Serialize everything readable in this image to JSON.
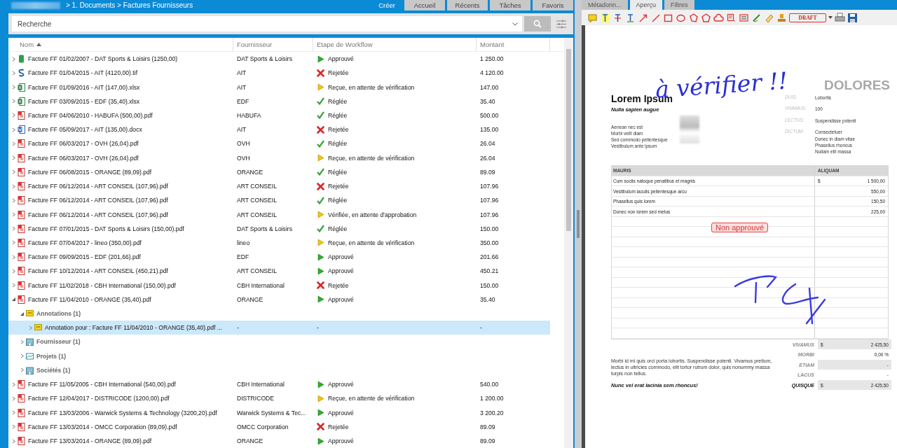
{
  "top_bar": {
    "breadcrumb": "> 1. Documents > Factures Fournisseurs",
    "create_label": "Créer",
    "tabs": [
      {
        "label": "Accueil",
        "selected": false
      },
      {
        "label": "Récents",
        "selected": false
      },
      {
        "label": "Tâches",
        "selected": false
      },
      {
        "label": "Favoris",
        "selected": false
      }
    ]
  },
  "search": {
    "placeholder": "Recherche"
  },
  "table": {
    "columns": [
      {
        "label": "Nom",
        "sorted": true
      },
      {
        "label": "Fournisseur",
        "sorted": false
      },
      {
        "label": "Etape de Workflow",
        "sorted": false
      },
      {
        "label": "Montant",
        "sorted": false
      }
    ],
    "rows": [
      {
        "kind": "file",
        "name": "Facture FF 01/02/2007 - DAT Sports & Loisirs (1250,00)",
        "supplier": "DAT Sports & Loisirs",
        "workflow": {
          "label": "Approuvé",
          "kind": "approved"
        },
        "amount": "1 250.00",
        "expanded": false,
        "selected": false
      },
      {
        "kind": "image",
        "name": "Facture FF 01/04/2015 - AIT (4120,00).tif",
        "supplier": "AIT",
        "workflow": {
          "label": "Rejetée",
          "kind": "rejected"
        },
        "amount": "4 120.00",
        "expanded": false,
        "selected": false
      },
      {
        "kind": "sheet",
        "name": "Facture FF 01/09/2016 - AIT (147,00).xlsx",
        "supplier": "AIT",
        "workflow": {
          "label": "Reçue, en attente de vérification",
          "kind": "pending"
        },
        "amount": "147.00",
        "expanded": false,
        "selected": false
      },
      {
        "kind": "sheet",
        "name": "Facture FF 03/09/2015 - EDF (35,40).xlsx",
        "supplier": "EDF",
        "workflow": {
          "label": "Réglée",
          "kind": "settled"
        },
        "amount": "35.40",
        "expanded": false,
        "selected": false
      },
      {
        "kind": "pdf",
        "name": "Facture FF 04/06/2010 - HABUFA (500,00).pdf",
        "supplier": "HABUFA",
        "workflow": {
          "label": "Réglée",
          "kind": "settled"
        },
        "amount": "500.00",
        "expanded": false,
        "selected": false
      },
      {
        "kind": "word",
        "name": "Facture FF 05/09/2017 - AIT (135,00).docx",
        "supplier": "AIT",
        "workflow": {
          "label": "Rejetée",
          "kind": "rejected"
        },
        "amount": "135.00",
        "expanded": false,
        "selected": false
      },
      {
        "kind": "pdf",
        "name": "Facture FF 06/03/2017 - OVH (26,04).pdf",
        "supplier": "OVH",
        "workflow": {
          "label": "Réglée",
          "kind": "settled"
        },
        "amount": "26.04",
        "expanded": false,
        "selected": false
      },
      {
        "kind": "pdf",
        "name": "Facture FF 06/03/2017 - OVH (26,04).pdf",
        "supplier": "OVH",
        "workflow": {
          "label": "Reçue, en attente de vérification",
          "kind": "pending"
        },
        "amount": "26.04",
        "expanded": false,
        "selected": false
      },
      {
        "kind": "pdf",
        "name": "Facture FF 06/08/2015 - ORANGE (89,09).pdf",
        "supplier": "ORANGE",
        "workflow": {
          "label": "Réglée",
          "kind": "settled"
        },
        "amount": "89.09",
        "expanded": false,
        "selected": false
      },
      {
        "kind": "pdf",
        "name": "Facture FF 06/12/2014 - ART CONSEIL (107,96).pdf",
        "supplier": "ART CONSEIL",
        "workflow": {
          "label": "Rejetée",
          "kind": "rejected"
        },
        "amount": "107.96",
        "expanded": false,
        "selected": false
      },
      {
        "kind": "pdf",
        "name": "Facture FF 06/12/2014 - ART CONSEIL (107,96).pdf",
        "supplier": "ART CONSEIL",
        "workflow": {
          "label": "Réglée",
          "kind": "settled"
        },
        "amount": "107.96",
        "expanded": false,
        "selected": false
      },
      {
        "kind": "pdf",
        "name": "Facture FF 06/12/2014 - ART CONSEIL (107,96).pdf",
        "supplier": "ART CONSEIL",
        "workflow": {
          "label": "Vérifiée, en attente d'approbation",
          "kind": "pending"
        },
        "amount": "107.96",
        "expanded": false,
        "selected": false
      },
      {
        "kind": "pdf",
        "name": "Facture FF 07/01/2015 - DAT Sports & Loisirs (150,00).pdf",
        "supplier": "DAT Sports & Loisirs",
        "workflow": {
          "label": "Réglée",
          "kind": "settled"
        },
        "amount": "150.00",
        "expanded": false,
        "selected": false
      },
      {
        "kind": "pdf",
        "name": "Facture FF 07/04/2017 - lineo (350,00).pdf",
        "supplier": "lineo",
        "workflow": {
          "label": "Reçue, en attente de vérification",
          "kind": "pending"
        },
        "amount": "350.00",
        "expanded": false,
        "selected": false
      },
      {
        "kind": "pdf",
        "name": "Facture FF 09/09/2015 - EDF (201,66).pdf",
        "supplier": "EDF",
        "workflow": {
          "label": "Approuvé",
          "kind": "approved"
        },
        "amount": "201.66",
        "expanded": false,
        "selected": false
      },
      {
        "kind": "pdf",
        "name": "Facture FF 10/12/2014 - ART CONSEIL (450,21).pdf",
        "supplier": "ART CONSEIL",
        "workflow": {
          "label": "Approuvé",
          "kind": "approved"
        },
        "amount": "450.21",
        "expanded": false,
        "selected": false
      },
      {
        "kind": "pdf",
        "name": "Facture FF 11/02/2018 - CBH International (150,00).pdf",
        "supplier": "CBH International",
        "workflow": {
          "label": "Rejetée",
          "kind": "rejected"
        },
        "amount": "150.00",
        "expanded": false,
        "selected": false
      },
      {
        "kind": "pdf",
        "name": "Facture FF 11/04/2010 - ORANGE (35,40).pdf",
        "supplier": "ORANGE",
        "workflow": {
          "label": "Approuvé",
          "kind": "approved"
        },
        "amount": "35.40",
        "expanded": true,
        "selected": false,
        "children": [
          {
            "kind": "annotations",
            "name": "Annotations (1)",
            "expanded": true,
            "selected": false,
            "children": [
              {
                "kind": "annotation",
                "name": "Annotation pour : Facture FF 11/04/2010 - ORANGE (35,40).pdf ...",
                "supplier": "-",
                "workflow": {
                  "label": "-"
                },
                "amount": "-",
                "expanded": false,
                "selected": true
              }
            ]
          },
          {
            "kind": "suppliers",
            "name": "Fournisseur (1)",
            "expanded": false,
            "selected": false
          },
          {
            "kind": "projects",
            "name": "Projets (1)",
            "expanded": false,
            "selected": false
          },
          {
            "kind": "companies",
            "name": "Sociétés (1)",
            "expanded": false,
            "selected": false
          }
        ]
      },
      {
        "kind": "pdf",
        "name": "Facture FF 11/05/2005 - CBH International (540,00).pdf",
        "supplier": "CBH International",
        "workflow": {
          "label": "Approuvé",
          "kind": "approved"
        },
        "amount": "540.00",
        "expanded": false,
        "selected": false
      },
      {
        "kind": "pdf",
        "name": "Facture FF 12/04/2017 - DISTRICODE (1200,00).pdf",
        "supplier": "DISTRICODE",
        "workflow": {
          "label": "Reçue, en attente de vérification",
          "kind": "pending"
        },
        "amount": "1 200.00",
        "expanded": false,
        "selected": false
      },
      {
        "kind": "pdf",
        "name": "Facture FF 13/03/2006 - Warwick Systems & Technology (3200,20).pdf",
        "supplier": "Warwick Systems & Tec...",
        "workflow": {
          "label": "Approuvé",
          "kind": "approved"
        },
        "amount": "3 200.20",
        "expanded": false,
        "selected": false
      },
      {
        "kind": "pdf",
        "name": "Facture FF 13/03/2014 - OMCC Corporation (89,09).pdf",
        "supplier": "OMCC Corporation",
        "workflow": {
          "label": "Rejetée",
          "kind": "rejected"
        },
        "amount": "89.09",
        "expanded": false,
        "selected": false
      },
      {
        "kind": "pdf",
        "name": "Facture FF 13/03/2014 - ORANGE (89,09).pdf",
        "supplier": "ORANGE",
        "workflow": {
          "label": "Approuvé",
          "kind": "approved"
        },
        "amount": "89.09",
        "expanded": false,
        "selected": false
      }
    ]
  },
  "side_panel": {
    "tabs": [
      {
        "label": "Métadonn...",
        "selected": false
      },
      {
        "label": "Aperçu",
        "selected": true
      },
      {
        "label": "Filtres",
        "selected": false
      }
    ],
    "stamp_label": "DRAFT"
  },
  "preview": {
    "handwritten_note": "à vérifier !!",
    "company": "DOLORES",
    "title": "Lorem Ipsum",
    "subtitle": "Nulla sapien augue",
    "address": [
      "Aenean nec est",
      "Morbi velit diam",
      "Sed commodo pellentesque",
      "Vestibulum ante ipsum"
    ],
    "fields": [
      {
        "label": "DUIS:",
        "values": [
          "Lobortis"
        ]
      },
      {
        "label": "VIVAMUS:",
        "values": [
          "100"
        ]
      },
      {
        "label": "LECTUS:",
        "values": [
          "Suspendisse potenti"
        ]
      },
      {
        "label": "DICTUM:",
        "values": [
          "Consectetuer",
          "Donec in diam vitae",
          "Phasellus rhoncus",
          "Nullam elit massa"
        ]
      }
    ],
    "columns": [
      "MAURIS",
      "ALIQUAM"
    ],
    "lines": [
      {
        "description": "Cum sociis natoque penatibus et magnis",
        "currency": "$",
        "amount": "1 500,00"
      },
      {
        "description": "Vestibulum iaculis pellentesque arcu",
        "amount": "550,00"
      },
      {
        "description": "Phasellus quis lorem",
        "amount": "150,50"
      },
      {
        "description": "Donec non lorem sed metus",
        "amount": "225,00"
      }
    ],
    "stamp": "Non approuvé",
    "totals": [
      {
        "kind": "line",
        "label": "VIVAMUS",
        "currency": "$",
        "amount": "2 425,50"
      },
      {
        "kind": "line",
        "label": "MORBI",
        "amount": "0,00 %"
      },
      {
        "kind": "line",
        "label": "ETIAM",
        "amount": "-"
      },
      {
        "kind": "line",
        "label": "LACUS",
        "amount": "-"
      },
      {
        "kind": "total",
        "label": "QUISQUE",
        "currency": "$",
        "amount": "2 425,50"
      }
    ],
    "note": "Morbi id mi quis orci porta lobortis. Suspendisse potenti. Vivamus pretium, lectus in ultricies commodo, elit tortor rutrum dolor, quis nonummy massa turpis non tellus.",
    "closing": "Nunc vel erat lacinia sem rhoncus!"
  }
}
